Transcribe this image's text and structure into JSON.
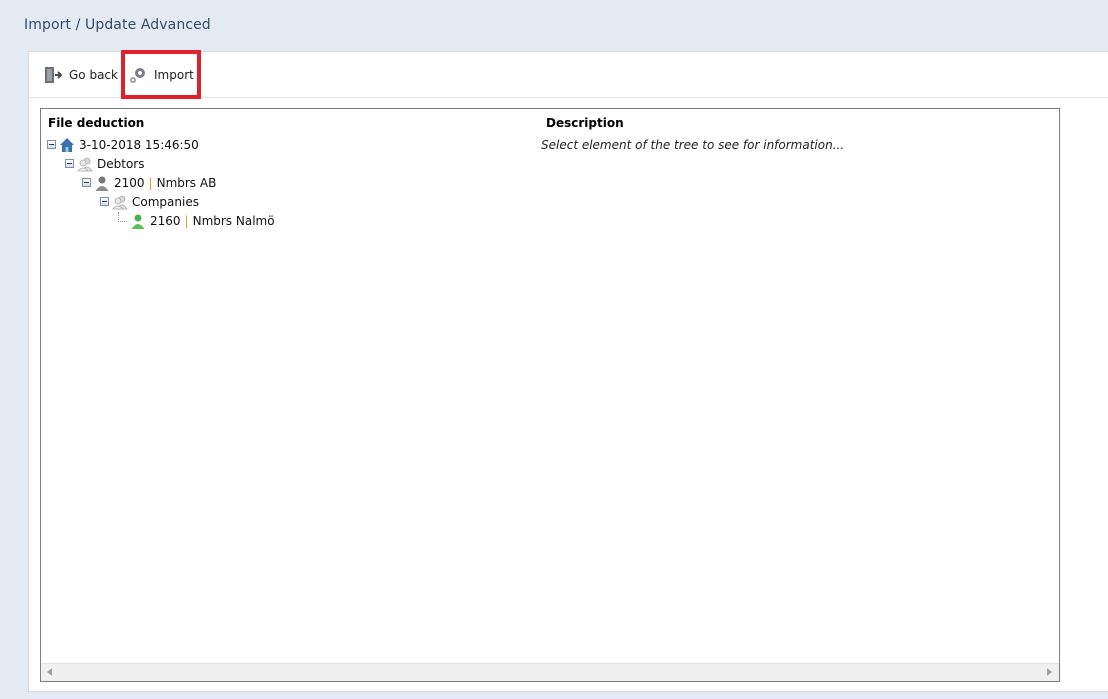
{
  "page": {
    "title": "Import / Update Advanced"
  },
  "toolbar": {
    "go_back_label": "Go back",
    "go_back_icon": "exit-door-icon",
    "import_label": "Import",
    "import_icon": "gears-icon"
  },
  "tree": {
    "columns": {
      "file": "File deduction",
      "description": "Description"
    },
    "description_text": "Select element of the tree to see for information...",
    "root": {
      "label": "3-10-2018 15:46:50",
      "icon": "house-icon"
    },
    "debtors": {
      "label": "Debtors",
      "icon": "group-icon"
    },
    "debtor": {
      "code": "2100",
      "name": "Nmbrs AB",
      "icon": "person-gray-icon"
    },
    "companies": {
      "label": "Companies",
      "icon": "group-icon"
    },
    "company": {
      "code": "2160",
      "name": "Nmbrs Nalmö",
      "icon": "person-green-icon"
    }
  },
  "colors": {
    "background": "#e4eaf3",
    "title": "#354a66",
    "highlight": "#e0202a",
    "separator": "#c7a23b"
  }
}
